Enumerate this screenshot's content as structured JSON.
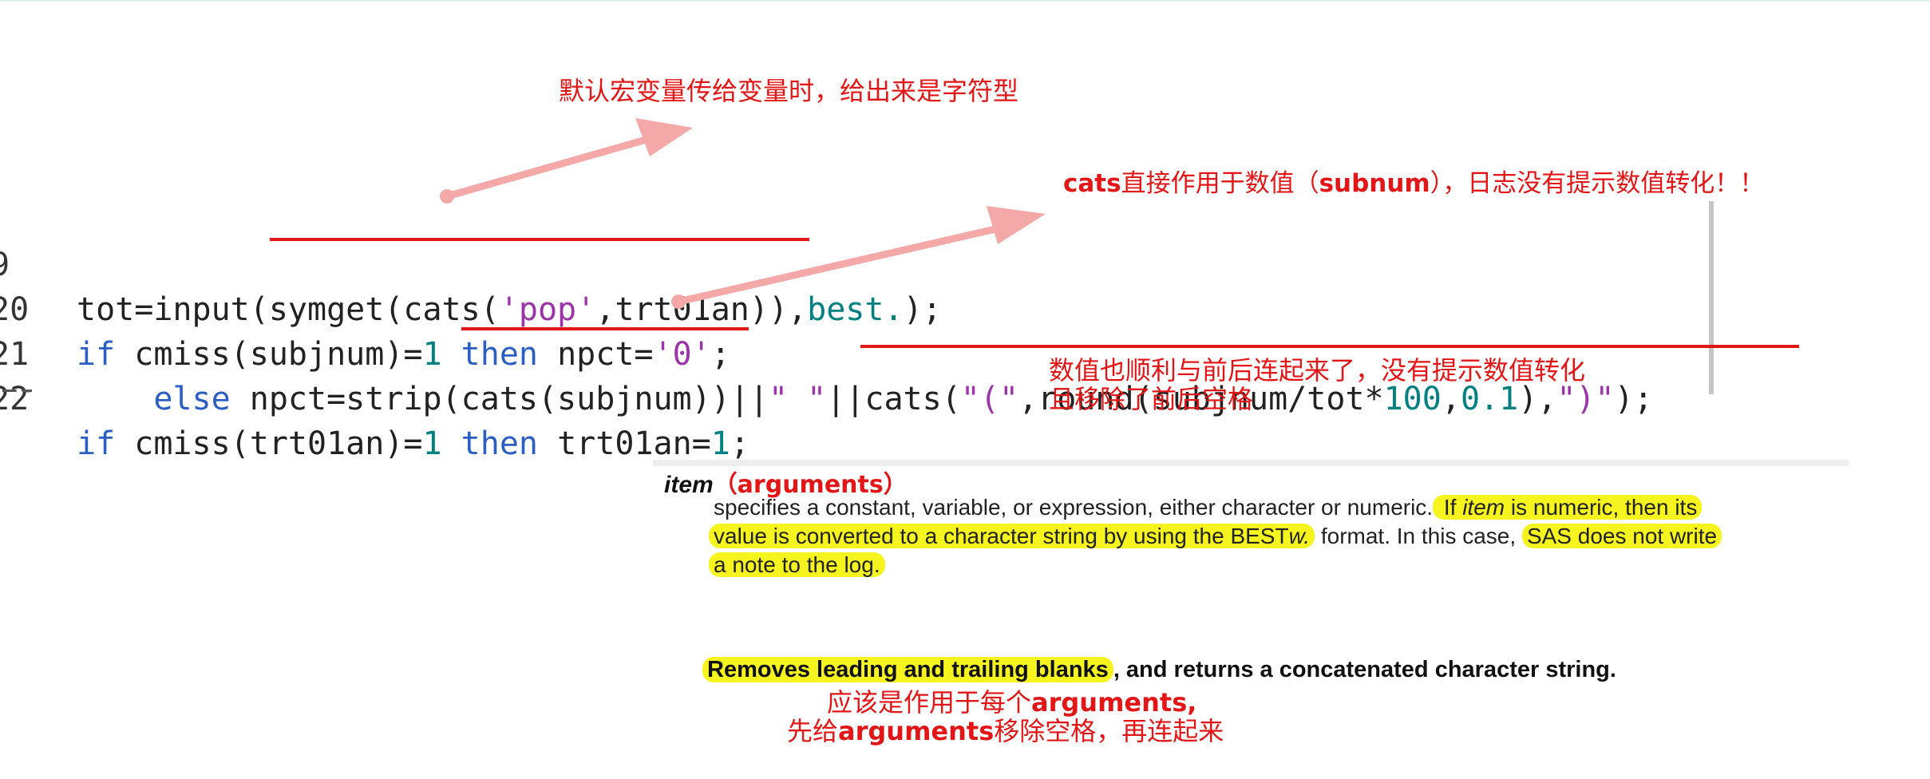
{
  "code_lines": [
    {
      "number": "9",
      "tokens": [
        {
          "t": "tot=input(symget(cats(",
          "c": ""
        },
        {
          "t": "'pop'",
          "c": "str"
        },
        {
          "t": ",trt01an)),",
          "c": ""
        },
        {
          "t": "best.",
          "c": "num"
        },
        {
          "t": ");",
          "c": ""
        }
      ]
    },
    {
      "number": "20",
      "tokens": [
        {
          "t": "if",
          "c": "kw"
        },
        {
          "t": " cmiss(subjnum)=",
          "c": ""
        },
        {
          "t": "1",
          "c": "num"
        },
        {
          "t": " ",
          "c": ""
        },
        {
          "t": "then",
          "c": "kw"
        },
        {
          "t": " npct=",
          "c": ""
        },
        {
          "t": "'0'",
          "c": "str"
        },
        {
          "t": ";",
          "c": ""
        }
      ]
    },
    {
      "number": "21",
      "tokens": [
        {
          "t": "    ",
          "c": ""
        },
        {
          "t": "else",
          "c": "kw"
        },
        {
          "t": " npct=strip(cats(subjnum))||",
          "c": ""
        },
        {
          "t": "\" \"",
          "c": "str"
        },
        {
          "t": "||cats(",
          "c": ""
        },
        {
          "t": "\"(\"",
          "c": "str"
        },
        {
          "t": ",round(subjnum/tot*",
          "c": ""
        },
        {
          "t": "100",
          "c": "num"
        },
        {
          "t": ",",
          "c": ""
        },
        {
          "t": "0.1",
          "c": "num"
        },
        {
          "t": "),",
          "c": ""
        },
        {
          "t": "\")\"",
          "c": "str"
        },
        {
          "t": ");",
          "c": ""
        }
      ]
    },
    {
      "number": "22",
      "tokens": [
        {
          "t": "if",
          "c": "kw"
        },
        {
          "t": " cmiss(trt01an)=",
          "c": ""
        },
        {
          "t": "1",
          "c": "num"
        },
        {
          "t": " ",
          "c": ""
        },
        {
          "t": "then",
          "c": "kw"
        },
        {
          "t": " trt01an=",
          "c": ""
        },
        {
          "t": "1",
          "c": "num"
        },
        {
          "t": ";",
          "c": ""
        }
      ]
    }
  ],
  "annotations": {
    "top_note": "默认宏变量传给变量时，给出来是字符型",
    "cats_note_pre": "cats",
    "cats_note_mid": "直接作用于数值（",
    "cats_note_var": "subnum",
    "cats_note_post": "），日志没有提示数值转化！！",
    "concat_note_line1": "数值也顺利与前后连起来了，没有提示数值转化",
    "concat_note_line2": "且移除了前后空格",
    "bottom_note_line1_pre": "应该是作用于每个",
    "bottom_note_line1_bold": "arguments,",
    "bottom_note_line2_pre": "先给",
    "bottom_note_line2_bold": "arguments",
    "bottom_note_line2_post": "移除空格，再连起来"
  },
  "doc": {
    "term": "item",
    "term_arg": "（arguments）",
    "desc_line1_a": "specifies a constant, variable, or expression, either character or numeric.",
    "desc_line1_b": " If ",
    "desc_line1_c": "item",
    "desc_line1_d": " is numeric, then its",
    "desc_line2_a": "value is converted to a character string by using the BEST",
    "desc_line2_b": "w.",
    "desc_line2_c": " format. In this case, ",
    "desc_line2_d": "SAS does not write",
    "desc_line3": "a note to the log.",
    "summary_hl": "Removes leading and trailing blanks",
    "summary_rest": ", and returns a concatenated character string."
  },
  "colors": {
    "annotation_red": "#e21616",
    "arrow_pink": "#f4a8a8",
    "highlight_yellow": "#f6f41e",
    "keyword_blue": "#2b5fc4",
    "number_teal": "#008080",
    "string_purple": "#9b34a8"
  }
}
